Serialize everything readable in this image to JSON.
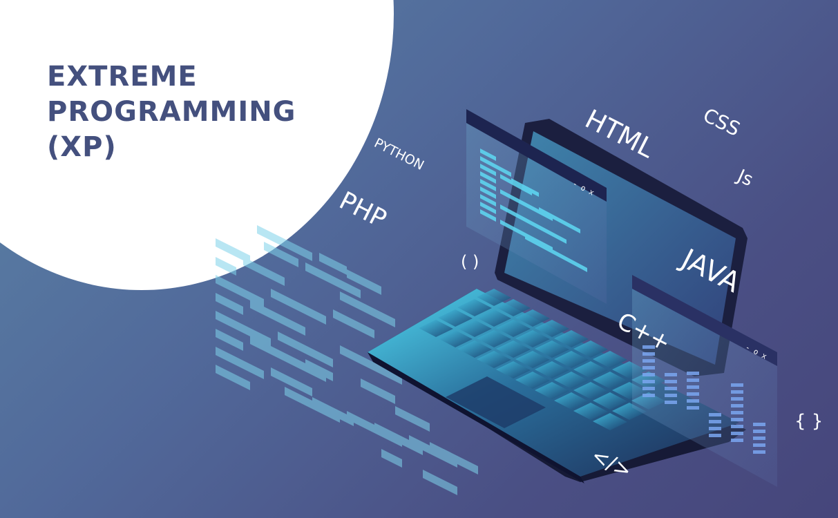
{
  "title": {
    "line1": "EXTREME",
    "line2": "PROGRAMMING",
    "line3": "(XP)"
  },
  "languages": {
    "html": "HTML",
    "css": "CSS",
    "js": "Js",
    "python": "PYTHON",
    "php": "PHP",
    "java": "JAVA",
    "cpp": "C++"
  },
  "symbols": {
    "parens": "( )",
    "braces": "{ }",
    "closing_tag": "</>"
  },
  "window_controls": "- o x",
  "colors": {
    "background_start": "#5b84a6",
    "background_end": "#46467b",
    "title": "#44507e",
    "accent_cyan": "#4fd6ee",
    "code_bars": "#7fd3ea"
  },
  "icons": [
    "laptop-illustration",
    "code-window",
    "chart-window",
    "code-lines"
  ]
}
